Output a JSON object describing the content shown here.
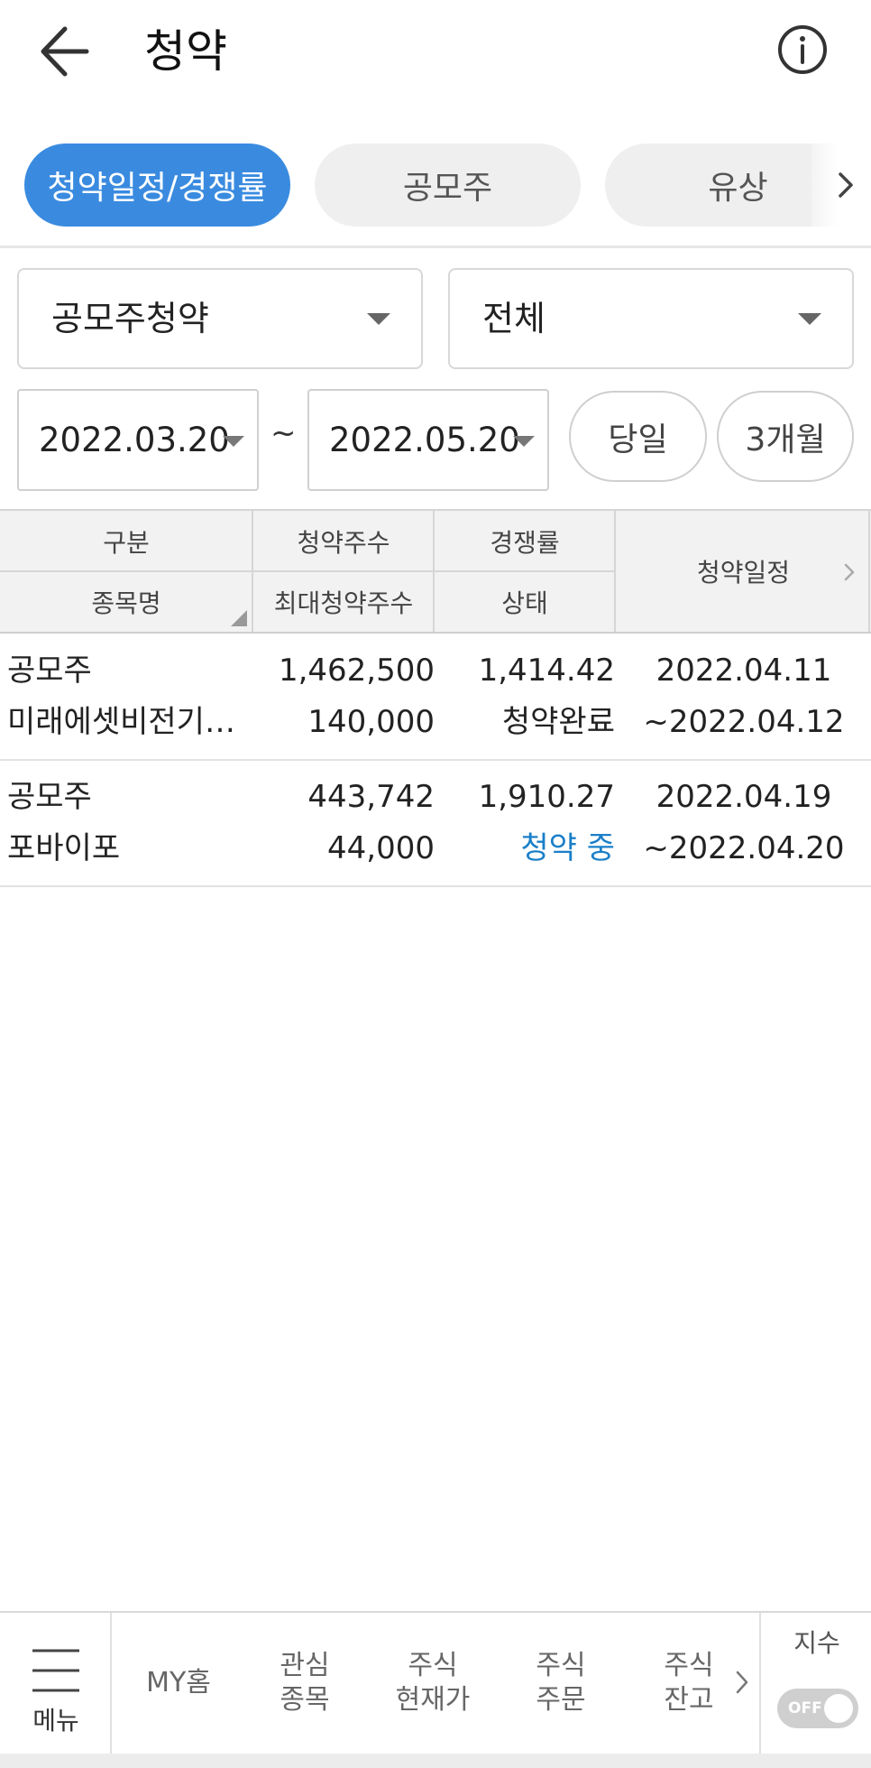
{
  "header": {
    "title": "청약",
    "back_icon": "arrow-left-icon",
    "info_icon": "info-circle-icon"
  },
  "tabs": [
    {
      "label": "청약일정/경쟁률",
      "active": true
    },
    {
      "label": "공모주",
      "active": false
    },
    {
      "label": "유상",
      "active": false
    }
  ],
  "filters": {
    "type_select": "공모주청약",
    "scope_select": "전체",
    "date_from": "2022.03.20",
    "date_separator": "~",
    "date_to": "2022.05.20",
    "today_button": "당일",
    "three_month_button": "3개월"
  },
  "table": {
    "headers": {
      "category": "구분",
      "name": "종목명",
      "sub_shares": "청약주수",
      "max_shares": "최대청약주수",
      "competition": "경쟁률",
      "status": "상태",
      "schedule": "청약일정"
    },
    "rows": [
      {
        "category": "공모주",
        "name": "미래에셋비전기…",
        "sub_shares": "1,462,500",
        "max_shares": "140,000",
        "competition": "1,414.42",
        "status": "청약완료",
        "start": "2022.04.11",
        "end": "~2022.04.12"
      },
      {
        "category": "공모주",
        "name": "포바이포",
        "sub_shares": "443,742",
        "max_shares": "44,000",
        "competition": "1,910.27",
        "status": "청약 중",
        "start": "2022.04.19",
        "end": "~2022.04.20"
      }
    ]
  },
  "bottom_nav": {
    "menu": "메뉴",
    "items": [
      "MY홈",
      "관심\n종목",
      "주식\n현재가",
      "주식\n주문",
      "주식\n잔고"
    ],
    "index_label": "지수",
    "toggle": "OFF"
  },
  "colors": {
    "accent": "#3a8be0",
    "status_active": "#1a7fc8"
  }
}
